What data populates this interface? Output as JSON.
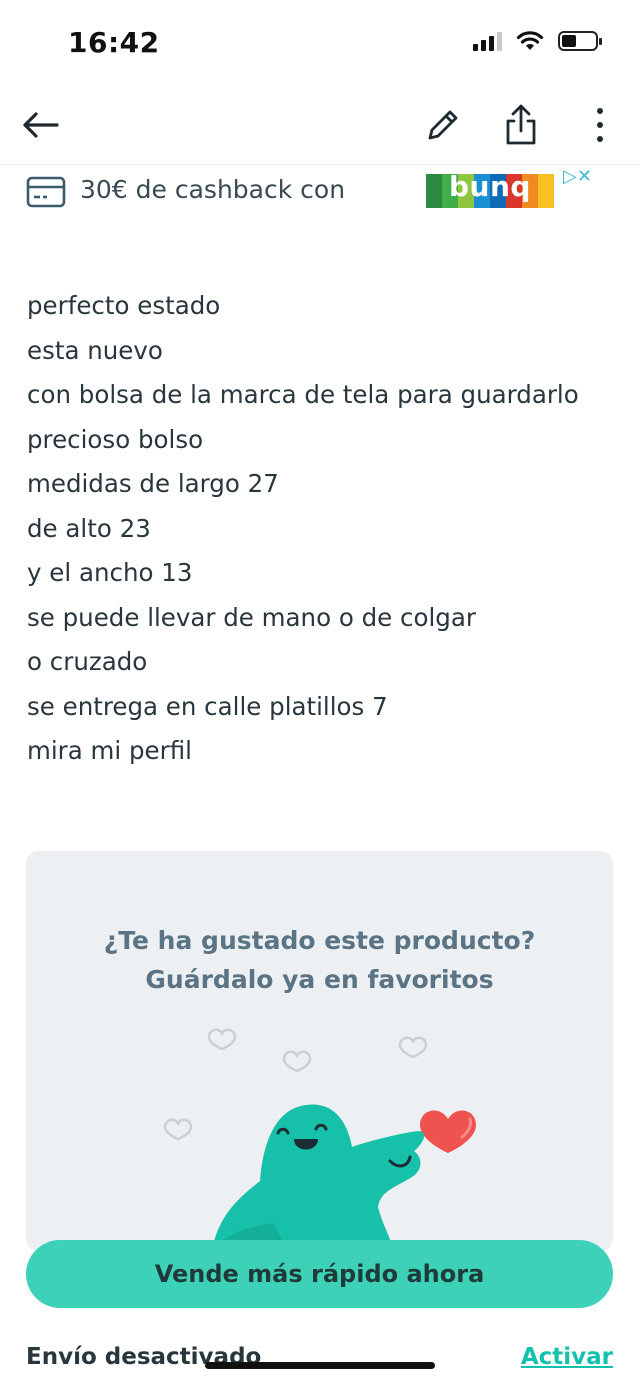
{
  "status_bar": {
    "time": "16:42"
  },
  "nav": {
    "back_icon": "arrow-left-icon",
    "edit_icon": "pencil-icon",
    "share_icon": "share-icon",
    "more_icon": "vertical-ellipsis-icon"
  },
  "ad": {
    "text": "30€ de cashback con",
    "brand": "bunq",
    "icon": "credit-card-icon",
    "brand_colors": [
      "#2b8a3e",
      "#3fae49",
      "#8ec63f",
      "#1b8fd3",
      "#0e6bb5",
      "#d9372a",
      "#f08b23",
      "#f6c121"
    ]
  },
  "description": {
    "lines": [
      "perfecto estado",
      "esta nuevo",
      "con bolsa de la marca de tela para guardarlo",
      "precioso bolso",
      "medidas de largo 27",
      "de alto 23",
      "y el ancho 13",
      "se puede llevar de mano o de colgar",
      "o cruzado",
      "se entrega en calle platillos 7",
      "mira mi perfil"
    ]
  },
  "favorite_promo": {
    "title_line1": "¿Te ha gustado este producto?",
    "title_line2": "Guárdalo ya en favoritos",
    "mascot_color": "#17c0a8",
    "heart_color": "#ef5350"
  },
  "cta": {
    "label": "Vende más rápido ahora",
    "color": "#3dd1b8"
  },
  "shipping": {
    "label": "Envío desactivado",
    "action": "Activar",
    "accent": "#13c1ac"
  }
}
